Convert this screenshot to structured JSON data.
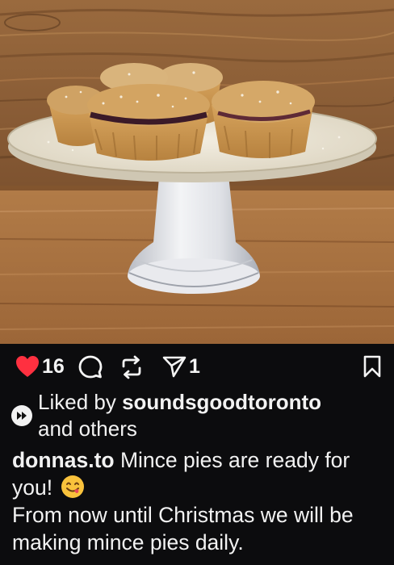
{
  "post": {
    "likes_count": "16",
    "shares_count": "1",
    "liked_by_prefix": "Liked by ",
    "liked_by_user": "soundsgoodtoronto",
    "liked_by_suffix": "and others",
    "caption_user": "donnas.to",
    "caption_line1": " Mince pies are ready for you! ",
    "caption_line2": "From now until Christmas we will be making mince pies daily."
  },
  "icons": {
    "like": "heart-icon",
    "comment": "comment-icon",
    "repost": "repost-icon",
    "share": "send-icon",
    "save": "bookmark-icon",
    "liked_badge": "play-badge-icon",
    "emoji": "yum-face-emoji"
  },
  "colors": {
    "background": "#0c0c0e",
    "heart": "#ff3040",
    "text": "#f2f2f2"
  }
}
